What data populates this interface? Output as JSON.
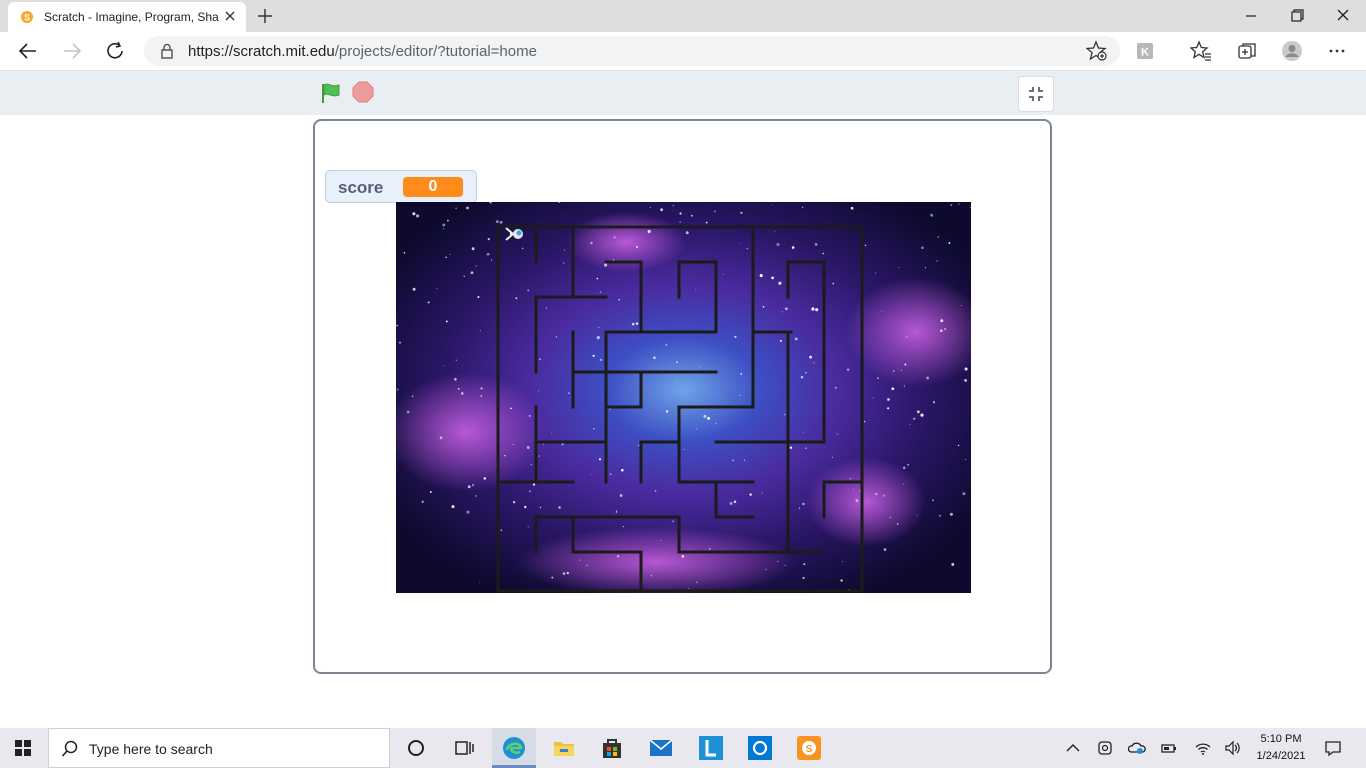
{
  "browser": {
    "tab_title": "Scratch - Imagine, Program, Sha",
    "url_host": "https://scratch.mit.edu",
    "url_path": "/projects/editor/?tutorial=home"
  },
  "stage": {
    "score_label": "score",
    "score_value": "0"
  },
  "taskbar": {
    "search_placeholder": "Type here to search",
    "time": "5:10 PM",
    "date": "1/24/2021"
  },
  "colors": {
    "flag_green": "#4cbf56",
    "stop_red": "#ec9c9c",
    "monitor_orange": "#ff8c1a",
    "edge_blue": "#1f8fd6"
  },
  "icons": [
    "scratch-favicon",
    "close-icon",
    "plus-icon",
    "minimize-icon",
    "restore-icon",
    "back-icon",
    "forward-icon",
    "refresh-icon",
    "lock-icon",
    "add-favorite-icon",
    "extension-icon",
    "favorites-icon",
    "collections-icon",
    "avatar-icon",
    "more-icon",
    "green-flag-icon",
    "stop-icon",
    "exit-fullscreen-icon",
    "windows-start-icon",
    "search-icon",
    "cortana-icon",
    "task-view-icon",
    "edge-icon",
    "file-explorer-icon",
    "store-icon",
    "mail-icon",
    "l-app-icon",
    "blue-app-icon",
    "scratch-app-icon",
    "chevron-up-icon",
    "meet-icon",
    "onedrive-icon",
    "battery-icon",
    "wifi-icon",
    "volume-icon",
    "notification-icon"
  ]
}
